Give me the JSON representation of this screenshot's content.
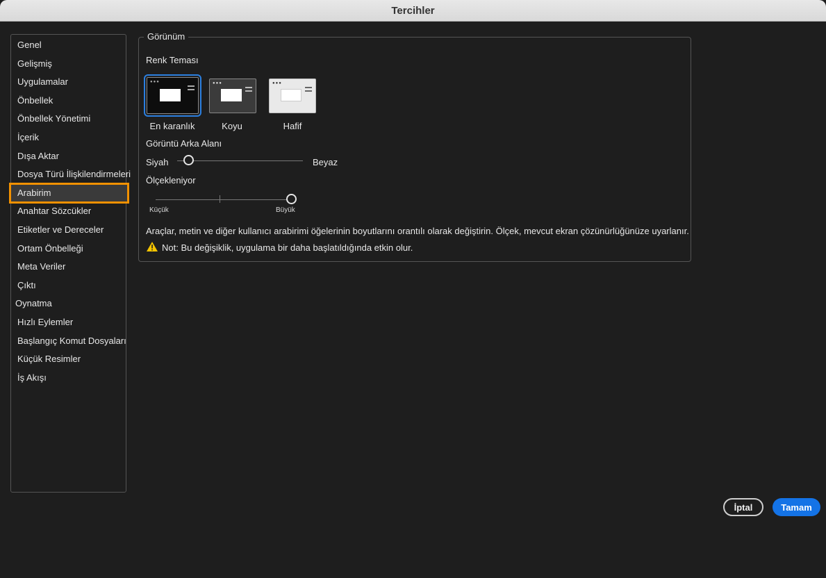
{
  "window": {
    "title": "Tercihler"
  },
  "sidebar": {
    "items": [
      {
        "label": "Genel"
      },
      {
        "label": "Gelişmiş"
      },
      {
        "label": "Uygulamalar"
      },
      {
        "label": "Önbellek"
      },
      {
        "label": "Önbellek Yönetimi"
      },
      {
        "label": "İçerik"
      },
      {
        "label": "Dışa Aktar"
      },
      {
        "label": "Dosya Türü İlişkilendirmeleri"
      },
      {
        "label": "Arabirim",
        "selected": true
      },
      {
        "label": "Anahtar Sözcükler"
      },
      {
        "label": "Etiketler ve Dereceler"
      },
      {
        "label": "Ortam Önbelleği"
      },
      {
        "label": "Meta Veriler"
      },
      {
        "label": "Çıktı"
      },
      {
        "label": "Oynatma"
      },
      {
        "label": "Hızlı Eylemler"
      },
      {
        "label": "Başlangıç Komut Dosyaları"
      },
      {
        "label": "Küçük Resimler"
      },
      {
        "label": "İş Akışı"
      }
    ]
  },
  "appearance": {
    "legend": "Görünüm",
    "color_theme_label": "Renk Teması",
    "themes": [
      {
        "label": "En karanlık",
        "selected": true
      },
      {
        "label": "Koyu",
        "selected": false
      },
      {
        "label": "Hafif",
        "selected": false
      }
    ],
    "background_label": "Görüntü Arka Alanı",
    "background_min": "Siyah",
    "background_max": "Beyaz",
    "background_value": 0.09,
    "scaling_label": "Ölçekleniyor",
    "scaling_min": "Küçük",
    "scaling_max": "Büyük",
    "scaling_value": 1.0,
    "description": "Araçlar, metin ve diğer kullanıcı arabirimi öğelerinin boyutlarını orantılı olarak değiştirin. Ölçek, mevcut ekran çözünürlüğünüze uyarlanır.",
    "note": "Not: Bu değişiklik, uygulama bir daha başlatıldığında etkin olur."
  },
  "buttons": {
    "cancel": "İptal",
    "ok": "Tamam"
  },
  "colors": {
    "accent": "#1473e6",
    "selection_outline": "#f29100",
    "warning": "#f5c400"
  }
}
